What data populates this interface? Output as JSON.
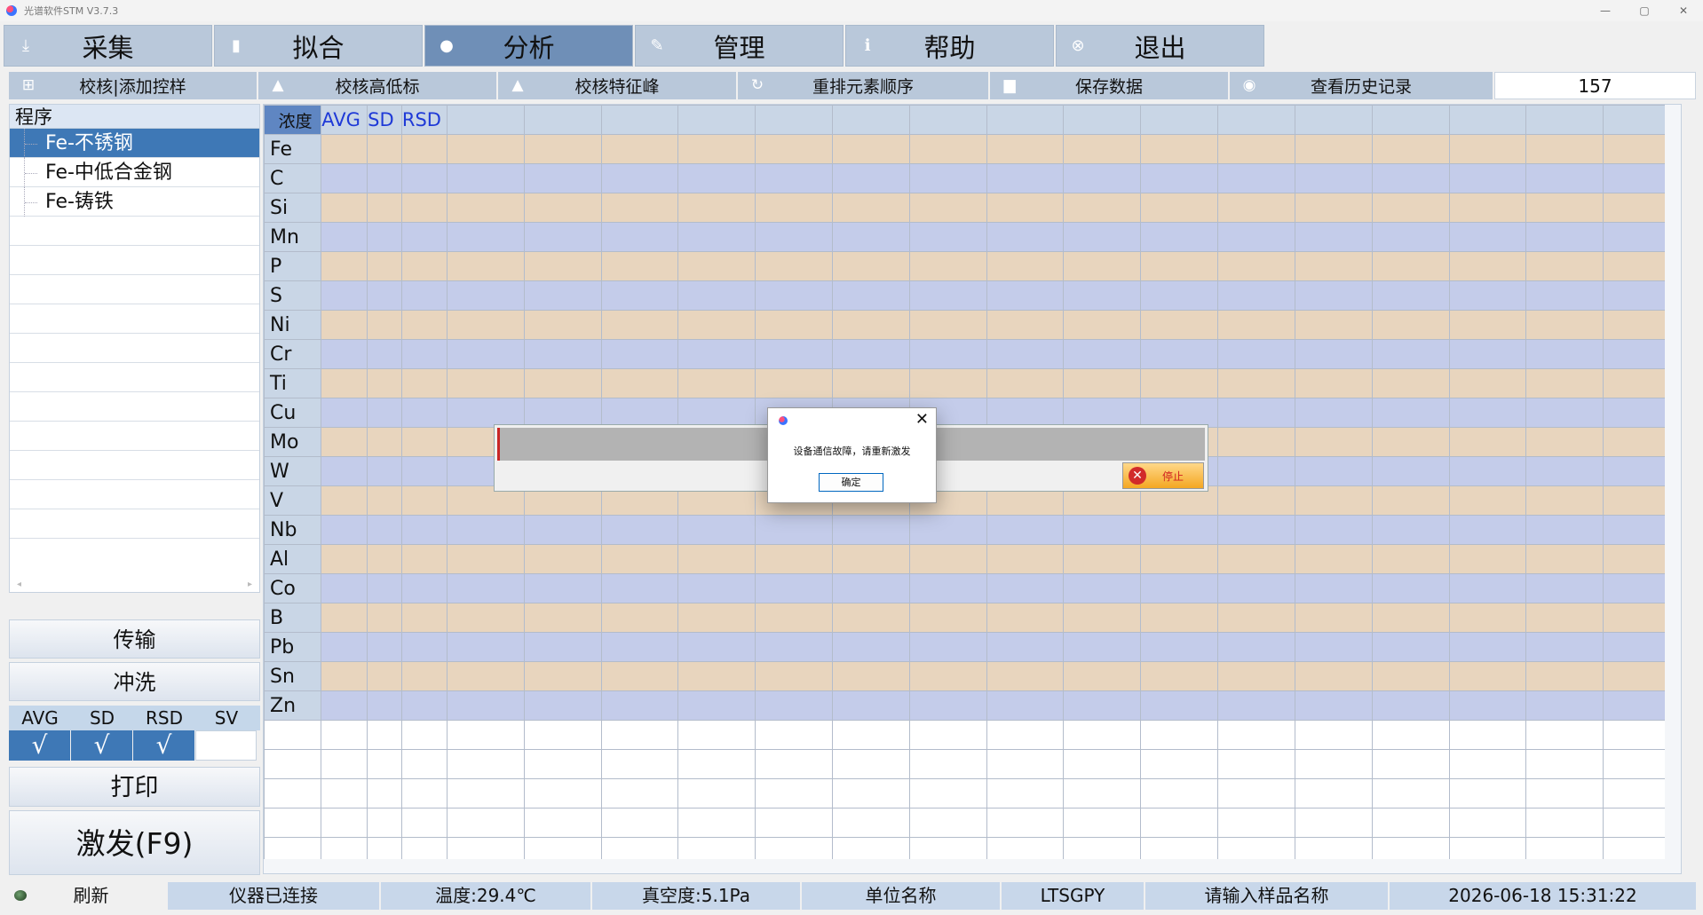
{
  "window": {
    "title": "光谱软件STM V3.7.3",
    "minimize": "—",
    "maximize": "▢",
    "close": "✕"
  },
  "main_tabs": [
    {
      "label": "采集",
      "icon": "import-icon",
      "glyph": "⤓"
    },
    {
      "label": "拟合",
      "icon": "bar-chart-icon",
      "glyph": "▮"
    },
    {
      "label": "分析",
      "icon": "user-icon",
      "glyph": "●",
      "active": true
    },
    {
      "label": "管理",
      "icon": "pencil-icon",
      "glyph": "✎"
    },
    {
      "label": "帮助",
      "icon": "info-icon",
      "glyph": "ℹ"
    },
    {
      "label": "退出",
      "icon": "close-circle-icon",
      "glyph": "⊗"
    }
  ],
  "toolbar": [
    {
      "label": "校核|添加控样",
      "icon": "plus-icon",
      "glyph": "⊞"
    },
    {
      "label": "校核高低标",
      "icon": "warning-icon",
      "glyph": "▲"
    },
    {
      "label": "校核特征峰",
      "icon": "warning-icon",
      "glyph": "▲"
    },
    {
      "label": "重排元素顺序",
      "icon": "refresh-icon",
      "glyph": "↻"
    },
    {
      "label": "保存数据",
      "icon": "sd-card-icon",
      "glyph": "▆"
    },
    {
      "label": "查看历史记录",
      "icon": "eye-icon",
      "glyph": "◉"
    }
  ],
  "count": "157",
  "program": {
    "header": "程序",
    "items": [
      "Fe-不锈钢",
      "Fe-中低合金钢",
      "Fe-铸铁"
    ]
  },
  "buttons": {
    "transfer": "传输",
    "flush": "冲洗",
    "print": "打印",
    "fire": "激发(F9)"
  },
  "stats": {
    "headers": [
      "AVG",
      "SD",
      "RSD",
      "SV"
    ],
    "checked": [
      true,
      true,
      true,
      false
    ],
    "check_glyph": "√"
  },
  "grid": {
    "corner": "浓度",
    "columns": [
      "AVG",
      "SD",
      "RSD"
    ],
    "elements": [
      "Fe",
      "C",
      "Si",
      "Mn",
      "P",
      "S",
      "Ni",
      "Cr",
      "Ti",
      "Cu",
      "Mo",
      "W",
      "V",
      "Nb",
      "Al",
      "Co",
      "B",
      "Pb",
      "Sn",
      "Zn"
    ]
  },
  "progress": {
    "stop_label": "停止"
  },
  "dialog": {
    "message": "设备通信故障，请重新激发",
    "ok": "确定",
    "close": "✕"
  },
  "status": {
    "refresh": "刷新",
    "instrument": "仪器已连接",
    "temperature": "温度:29.4℃",
    "vacuum": "真空度:5.1Pa",
    "unit": "单位名称",
    "code": "LTSGPY",
    "sample": "请输入样品名称",
    "datetime": "2026-06-18 15:31:22"
  }
}
